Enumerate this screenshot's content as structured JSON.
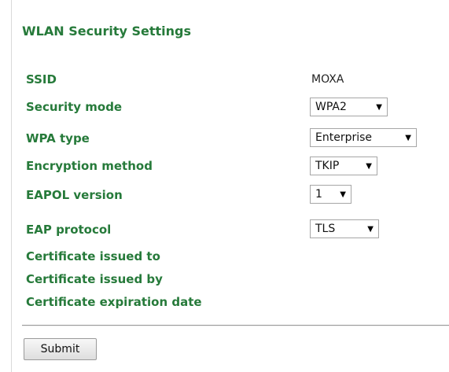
{
  "section_title": "WLAN Security Settings",
  "fields": {
    "ssid": {
      "label": "SSID",
      "value": "MOXA"
    },
    "security_mode": {
      "label": "Security mode",
      "value": "WPA2"
    },
    "wpa_type": {
      "label": "WPA type",
      "value": "Enterprise"
    },
    "encryption_method": {
      "label": "Encryption method",
      "value": "TKIP"
    },
    "eapol_version": {
      "label": "EAPOL version",
      "value": "1"
    },
    "eap_protocol": {
      "label": "EAP protocol",
      "value": "TLS"
    },
    "cert_issued_to": {
      "label": "Certificate issued to"
    },
    "cert_issued_by": {
      "label": "Certificate issued by"
    },
    "cert_expiration": {
      "label": "Certificate expiration date"
    }
  },
  "actions": {
    "submit_label": "Submit"
  },
  "colors": {
    "label_green": "#267a3a"
  },
  "icons": {
    "dropdown": "triangle-down-icon"
  }
}
